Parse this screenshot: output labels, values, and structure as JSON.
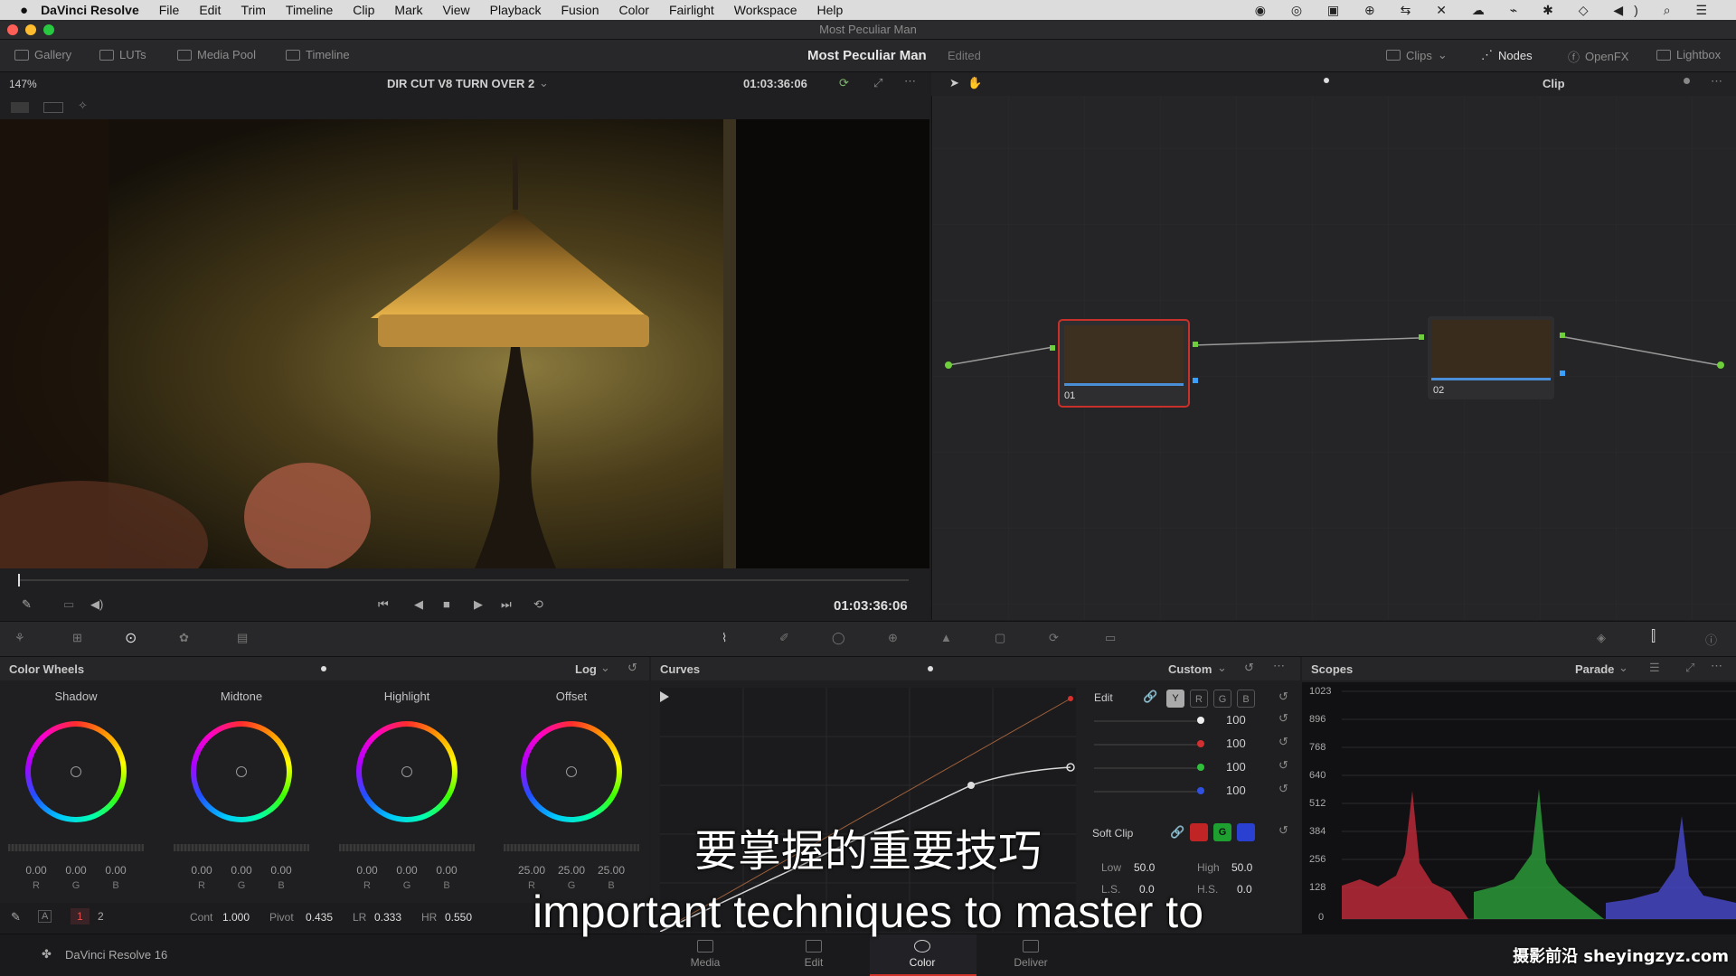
{
  "menubar": {
    "app": "DaVinci Resolve",
    "items": [
      "File",
      "Edit",
      "Trim",
      "Timeline",
      "Clip",
      "Mark",
      "View",
      "Playback",
      "Fusion",
      "Color",
      "Fairlight",
      "Workspace",
      "Help"
    ]
  },
  "window": {
    "title": "Most Peculiar Man"
  },
  "toolbar": {
    "gallery": "Gallery",
    "luts": "LUTs",
    "media_pool": "Media Pool",
    "timeline": "Timeline",
    "project": "Most Peculiar Man",
    "status": "Edited",
    "clips": "Clips",
    "nodes": "Nodes",
    "openfx": "OpenFX",
    "lightbox": "Lightbox"
  },
  "viewer": {
    "zoom": "147%",
    "timeline_name": "DIR CUT V8 TURN OVER 2",
    "timecode_top": "01:03:36:06",
    "timecode": "01:03:36:06"
  },
  "node_editor": {
    "mode": "Clip",
    "nodes": [
      {
        "id": "01"
      },
      {
        "id": "02"
      }
    ]
  },
  "color_wheels": {
    "title": "Color Wheels",
    "mode": "Log",
    "wheels": [
      {
        "label": "Shadow",
        "values": [
          "0.00",
          "0.00",
          "0.00"
        ]
      },
      {
        "label": "Midtone",
        "values": [
          "0.00",
          "0.00",
          "0.00"
        ]
      },
      {
        "label": "Highlight",
        "values": [
          "0.00",
          "0.00",
          "0.00"
        ]
      },
      {
        "label": "Offset",
        "values": [
          "25.00",
          "25.00",
          "25.00"
        ]
      }
    ],
    "channel_labels": [
      "R",
      "G",
      "B"
    ],
    "page1": "1",
    "page2": "2",
    "cont_label": "Cont",
    "cont": "1.000",
    "pivot_label": "Pivot",
    "pivot": "0.435",
    "lr_label": "LR",
    "lr": "0.333",
    "hr_label": "HR",
    "hr": "0.550"
  },
  "curves": {
    "title": "Curves",
    "mode": "Custom",
    "edit_label": "Edit",
    "channels": [
      "Y",
      "R",
      "G",
      "B"
    ],
    "intensities": [
      "100",
      "100",
      "100",
      "100"
    ],
    "softclip_label": "Soft Clip",
    "low_label": "Low",
    "low": "50.0",
    "high_label": "High",
    "high": "50.0",
    "ls_label": "L.S.",
    "ls": "0.0",
    "hs_label": "H.S.",
    "hs": "0.0"
  },
  "scopes": {
    "title": "Scopes",
    "mode": "Parade",
    "scale": [
      "1023",
      "896",
      "768",
      "640",
      "512",
      "384",
      "256",
      "128",
      "0"
    ]
  },
  "pages": {
    "app_version": "DaVinci Resolve 16",
    "tabs": [
      "Media",
      "Edit",
      "Color",
      "Deliver"
    ],
    "active": "Color"
  },
  "subtitles": {
    "zh": "要掌握的重要技巧",
    "en": "important techniques to master to"
  },
  "watermark": "摄影前沿 sheyingzyz.com",
  "colors": {
    "accent": "#d0332a",
    "node_selected": "#c8302a",
    "panel": "#1f1f21"
  }
}
